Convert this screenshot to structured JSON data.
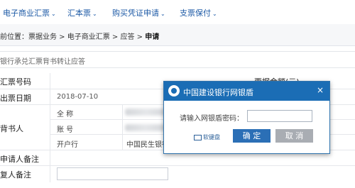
{
  "nav": {
    "items": [
      {
        "label": "电子商业汇票"
      },
      {
        "label": "汇本票"
      },
      {
        "label": "购买凭证申请"
      },
      {
        "label": "支票保付"
      }
    ]
  },
  "breadcrumb": {
    "prefix": "前位置：票据业务 > 电子商业汇票 > 应答 > ",
    "current": "申请"
  },
  "section": {
    "title": "银行承兑汇票背书转让应答"
  },
  "form": {
    "bill_no_label": "汇票号码",
    "amount_label": "票据金额(元)",
    "amount_tail": "…",
    "date_label": "出票日期",
    "date_value": "2018-07-10",
    "endorser_label": "背书人",
    "name_label": "全 称",
    "account_label": "账 号",
    "bank_label": "开户行",
    "bank_value": "中国民生银行",
    "applicant_note_label": "申请人备注",
    "responder_note_label": "复人备注"
  },
  "modal": {
    "title": "中国建设银行网银盾",
    "close": "×",
    "password_label": "请输入网银盾密码：",
    "password_value": "",
    "soft_keyboard": "软键盘",
    "ok": "确 定",
    "cancel": "取 消"
  }
}
